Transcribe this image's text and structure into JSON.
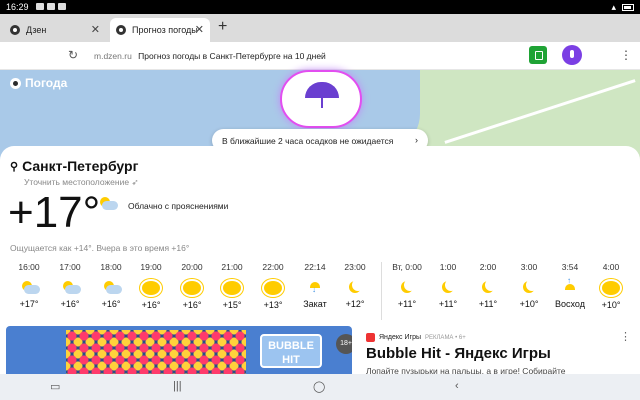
{
  "status_bar": {
    "time": "16:29"
  },
  "tabs": [
    {
      "label": "Дзен"
    },
    {
      "label": "Прогноз погоды"
    }
  ],
  "address_bar": {
    "domain": "m.dzen.ru",
    "title": "Прогноз погоды в Санкт-Петербурге на 10 дней"
  },
  "map": {
    "logo": "Погода",
    "precip_note": "В ближайшие 2 часа осадков не ожидается"
  },
  "weather": {
    "city": "Санкт-Петербург",
    "refine_location": "Уточнить местоположение",
    "temperature": "+17°",
    "condition": "Облачно с прояснениями",
    "feels_like": "Ощущается как +14°. Вчера в это время +16°"
  },
  "hourly": [
    {
      "time": "16:00",
      "icon": "partly-cloudy-icon",
      "value": "+17°"
    },
    {
      "time": "17:00",
      "icon": "partly-cloudy-icon",
      "value": "+16°"
    },
    {
      "time": "18:00",
      "icon": "partly-cloudy-icon",
      "value": "+16°"
    },
    {
      "time": "19:00",
      "icon": "sun-icon",
      "value": "+16°"
    },
    {
      "time": "20:00",
      "icon": "sun-icon",
      "value": "+16°"
    },
    {
      "time": "21:00",
      "icon": "sun-icon",
      "value": "+15°"
    },
    {
      "time": "22:00",
      "icon": "sun-icon",
      "value": "+13°"
    },
    {
      "time": "22:14",
      "icon": "sunset-icon",
      "value": "Закат"
    },
    {
      "time": "23:00",
      "icon": "moon-icon",
      "value": "+12°"
    },
    {
      "time": "Вт, 0:00",
      "icon": "moon-icon",
      "value": "+11°"
    },
    {
      "time": "1:00",
      "icon": "moon-icon",
      "value": "+11°"
    },
    {
      "time": "2:00",
      "icon": "moon-icon",
      "value": "+11°"
    },
    {
      "time": "3:00",
      "icon": "moon-icon",
      "value": "+10°"
    },
    {
      "time": "3:54",
      "icon": "sunrise-icon",
      "value": "Восход"
    },
    {
      "time": "4:00",
      "icon": "sun-icon",
      "value": "+10°"
    }
  ],
  "ad": {
    "source": "Яндекс Игры",
    "marker": "РЕКЛАМА • 6+",
    "title": "Bubble Hit - Яндекс Игры",
    "text": "Лопайте пузырьки на пальцы, а в игре! Собирайте",
    "image_label": "BUBBLE HIT",
    "age": "18+"
  }
}
